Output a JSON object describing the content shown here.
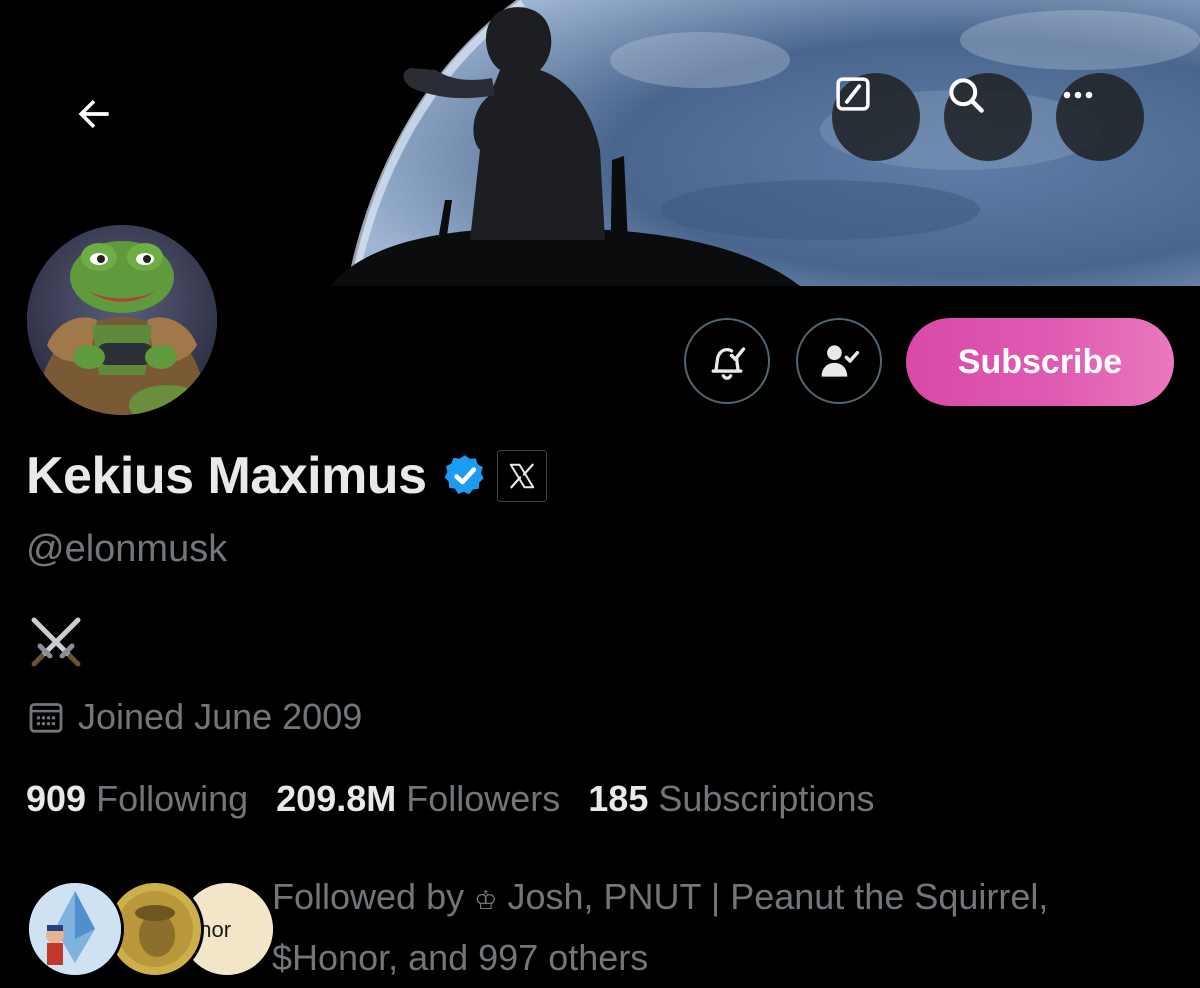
{
  "header": {
    "back_icon": "arrow-left-icon",
    "actions": [
      {
        "name": "edit-button",
        "icon": "slash-box-icon"
      },
      {
        "name": "search-button",
        "icon": "search-icon"
      },
      {
        "name": "more-button",
        "icon": "more-horizontal-icon"
      }
    ]
  },
  "profile": {
    "display_name": "Kekius Maximus",
    "handle": "@elonmusk",
    "verified_icon": "verified-badge-icon",
    "affiliation_badge_glyph": "𝕏",
    "bio_icon": "crossed-swords-icon",
    "joined": "Joined June 2009",
    "subscribe_label": "Subscribe",
    "notifications_icon": "bell-check-icon",
    "following_icon": "person-check-icon"
  },
  "stats": {
    "following": {
      "value": "909",
      "label": "Following"
    },
    "followers": {
      "value": "209.8M",
      "label": "Followers"
    },
    "subscriptions": {
      "value": "185",
      "label": "Subscriptions"
    }
  },
  "followed_by": {
    "prefix": "Followed by",
    "crown_glyph": "♔",
    "rest": "Josh, PNUT | Peanut the Squirrel, $Honor, and 997 others",
    "avatar3_text": "onor"
  },
  "colors": {
    "background": "#000000",
    "primary_text": "#e7e9ea",
    "secondary_text": "#71767b",
    "verified_blue": "#1d9bf0",
    "subscribe_gradient_start": "#d84aa6",
    "subscribe_gradient_end": "#e979bc",
    "outline_border": "#536471"
  }
}
